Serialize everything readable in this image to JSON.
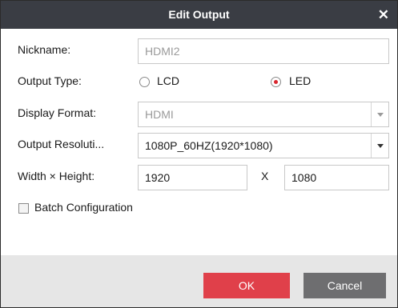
{
  "dialog": {
    "title": "Edit Output",
    "close_icon": "close-icon"
  },
  "form": {
    "nickname": {
      "label": "Nickname:",
      "value": "HDMI2"
    },
    "output_type": {
      "label": "Output Type:",
      "options": [
        {
          "label": "LCD",
          "selected": false
        },
        {
          "label": "LED",
          "selected": true
        }
      ]
    },
    "display_format": {
      "label": "Display Format:",
      "value": "HDMI"
    },
    "output_resolution": {
      "label": "Output Resoluti...",
      "value": "1080P_60HZ(1920*1080)"
    },
    "width_height": {
      "label": "Width × Height:",
      "width": "1920",
      "separator": "X",
      "height": "1080"
    },
    "batch_configuration": {
      "label": "Batch Configuration",
      "checked": false
    }
  },
  "footer": {
    "ok_label": "OK",
    "cancel_label": "Cancel"
  },
  "colors": {
    "titlebar": "#3a3d44",
    "ok_button": "#e0404a",
    "cancel_button": "#6e6e70",
    "radio_selected": "#d9262e"
  }
}
